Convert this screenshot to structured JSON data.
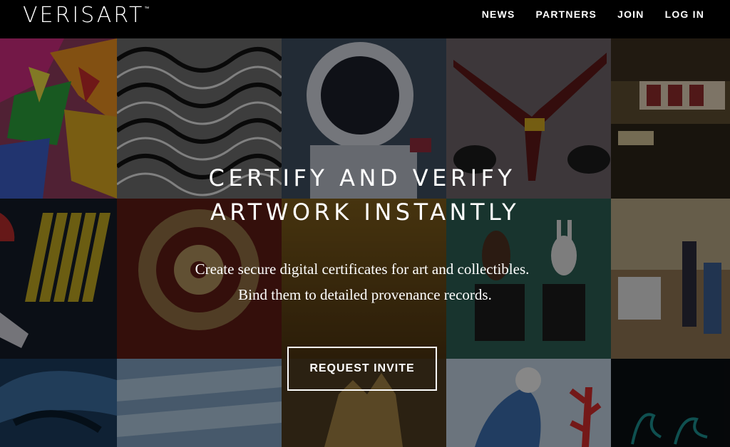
{
  "header": {
    "logo_text": "VERISART",
    "logo_mark": "™",
    "nav": [
      "NEWS",
      "PARTNERS",
      "JOIN",
      "LOG IN"
    ]
  },
  "hero": {
    "headline_line1": "CERTIFY AND VERIFY",
    "headline_line2": "ARTWORK INSTANTLY",
    "subtitle_line1": "Create secure digital certificates for art and collectibles.",
    "subtitle_line2": "Bind them to detailed provenance records.",
    "cta_label": "REQUEST INVITE"
  },
  "colors": {
    "header_bg": "#000000",
    "text": "#ffffff",
    "overlay": "rgba(0,0,0,0.42)"
  }
}
